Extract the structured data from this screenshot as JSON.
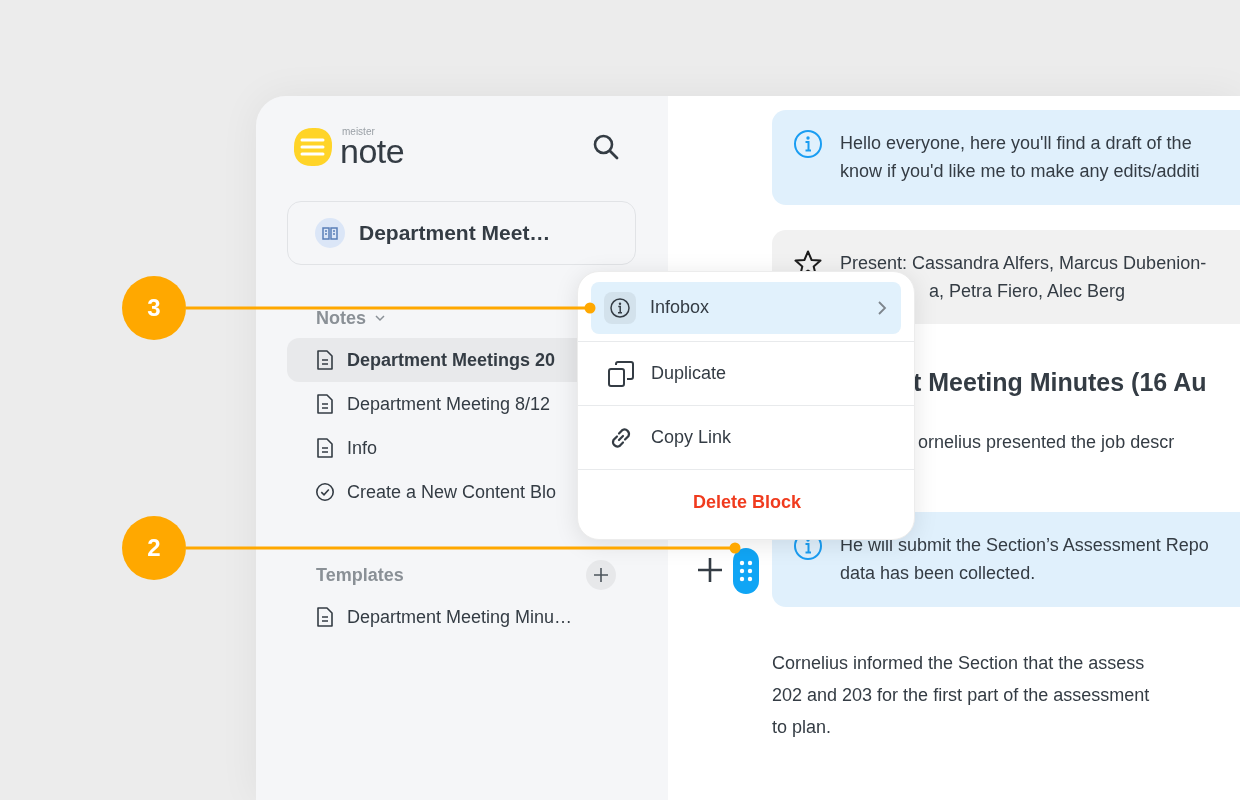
{
  "logo": {
    "small": "meister",
    "name": "note"
  },
  "notebook": {
    "title": "Department Meet…"
  },
  "notes_section": {
    "title": "Notes",
    "expanded": true
  },
  "notes": [
    {
      "title": "Department Meetings 20",
      "kind": "doc",
      "selected": true
    },
    {
      "title": "Department Meeting 8/12",
      "kind": "doc",
      "selected": false
    },
    {
      "title": "Info",
      "kind": "doc",
      "selected": false
    },
    {
      "title": "Create a New Content Blo",
      "kind": "task",
      "selected": false
    }
  ],
  "templates_section": {
    "title": "Templates"
  },
  "templates": [
    {
      "title": "Department Meeting Minu…",
      "kind": "doc",
      "selected": false
    }
  ],
  "blocks": [
    {
      "kind": "infobox",
      "lines": [
        {
          "text": "Hello everyone, here you'll find a draft of the",
          "cut_start": false
        },
        {
          "text": "know if you'd like me to make any edits/additi",
          "cut_start": false
        }
      ]
    },
    {
      "kind": "highlight",
      "lines": [
        {
          "text": "Present: Cassandra Alfers, Marcus Dubenion-",
          "cut_start": false
        },
        {
          "text": "a, Petra Fiero, Alec Berg",
          "cut_start": true
        }
      ]
    },
    {
      "kind": "heading",
      "lines": [
        {
          "text": "t Meeting Minutes (16 Au",
          "cut_start": true
        }
      ]
    },
    {
      "kind": "paragraph",
      "lines": [
        {
          "text": "ornelius presented the job descr",
          "cut_start": true
        }
      ]
    },
    {
      "kind": "infobox",
      "lines": [
        {
          "text": "He will submit the Section’s Assessment Repo",
          "cut_start": false
        },
        {
          "text": "data has been collected.",
          "cut_start": false
        }
      ]
    },
    {
      "kind": "paragraph",
      "lines": [
        {
          "text": "Cornelius informed the Section that the assess",
          "cut_start": false
        },
        {
          "text": "202 and 203 for the first part of the assessment",
          "cut_start": false
        },
        {
          "text": "to plan.",
          "cut_start": false
        }
      ]
    }
  ],
  "menu": [
    {
      "label": "Infobox",
      "kind": "submenu",
      "selected": true
    },
    {
      "label": "Duplicate",
      "kind": "duplicate",
      "selected": false
    },
    {
      "label": "Copy Link",
      "kind": "link",
      "selected": false
    },
    {
      "label": "Delete Block",
      "kind": "danger",
      "selected": false
    }
  ],
  "callouts": [
    {
      "number": "3"
    },
    {
      "number": "2"
    }
  ]
}
